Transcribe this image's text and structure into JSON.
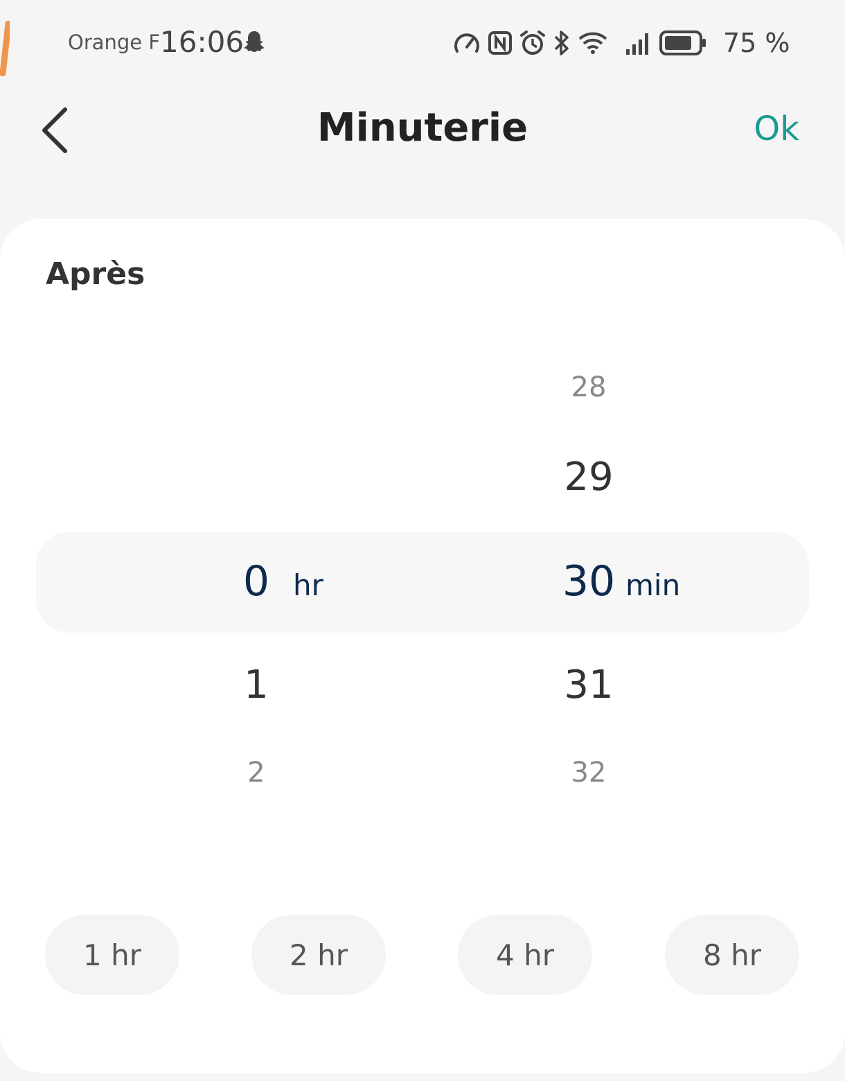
{
  "status_bar": {
    "carrier": "Orange F",
    "time": "16:06",
    "battery_percent": "75 %"
  },
  "header": {
    "title": "Minuterie",
    "ok_label": "Ok"
  },
  "section": {
    "label": "Après"
  },
  "picker": {
    "hours": {
      "prev2": "",
      "prev1": "",
      "selected": "0",
      "next1": "1",
      "next2": "2",
      "unit": "hr"
    },
    "minutes": {
      "prev2": "28",
      "prev1": "29",
      "selected": "30",
      "next1": "31",
      "next2": "32",
      "unit": "min"
    }
  },
  "presets": [
    {
      "label": "1 hr"
    },
    {
      "label": "2 hr"
    },
    {
      "label": "4 hr"
    },
    {
      "label": "8 hr"
    }
  ],
  "colors": {
    "accent": "#1a9a92",
    "selected_text": "#0d2a4d",
    "orange_mark": "#f0954a"
  },
  "icons": [
    "snapchat-icon",
    "speed-icon",
    "nfc-icon",
    "alarm-icon",
    "bluetooth-icon",
    "wifi-icon",
    "signal-icon",
    "battery-icon",
    "back-icon"
  ]
}
